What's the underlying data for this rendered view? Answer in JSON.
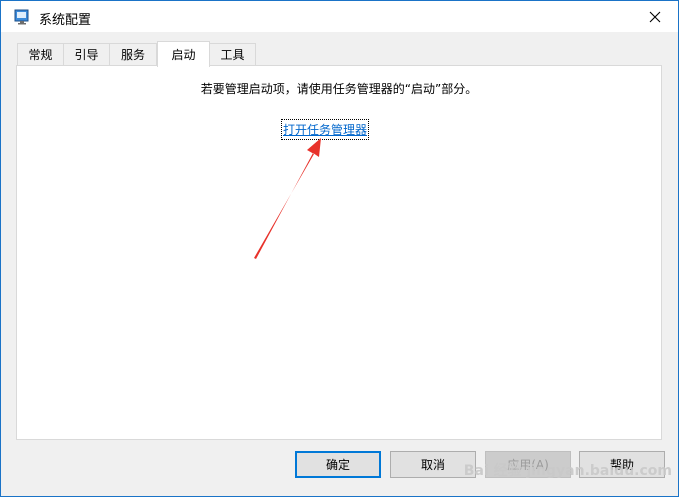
{
  "window": {
    "title": "系统配置"
  },
  "tabs": [
    {
      "label": "常规"
    },
    {
      "label": "引导"
    },
    {
      "label": "服务"
    },
    {
      "label": "启动",
      "active": true
    },
    {
      "label": "工具"
    }
  ],
  "content": {
    "info": "若要管理启动项，请使用任务管理器的“启动”部分。",
    "link": "打开任务管理器"
  },
  "buttons": {
    "ok": "确定",
    "cancel": "取消",
    "apply": "应用(A)",
    "help": "帮助"
  },
  "annotation": {
    "arrow_color": "#e8322b"
  },
  "watermark": {
    "text": "Bai 经验 jingyan.baidu.com"
  }
}
